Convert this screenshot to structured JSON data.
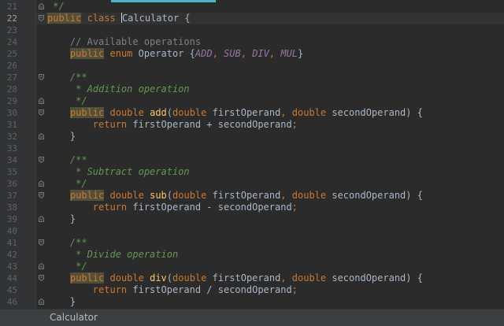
{
  "editor": {
    "current_line": "22",
    "lines": [
      {
        "n": "21",
        "t": " */"
      },
      {
        "n": "22",
        "t": "public class Calculator {"
      },
      {
        "n": "23",
        "t": ""
      },
      {
        "n": "24",
        "t": "    // Available operations"
      },
      {
        "n": "25",
        "t": "    public enum Operator {ADD, SUB, DIV, MUL}"
      },
      {
        "n": "26",
        "t": ""
      },
      {
        "n": "27",
        "t": "    /**"
      },
      {
        "n": "28",
        "t": "     * Addition operation"
      },
      {
        "n": "29",
        "t": "     */"
      },
      {
        "n": "30",
        "t": "    public double add(double firstOperand, double secondOperand) {"
      },
      {
        "n": "31",
        "t": "        return firstOperand + secondOperand;"
      },
      {
        "n": "32",
        "t": "    }"
      },
      {
        "n": "33",
        "t": ""
      },
      {
        "n": "34",
        "t": "    /**"
      },
      {
        "n": "35",
        "t": "     * Subtract operation"
      },
      {
        "n": "36",
        "t": "     */"
      },
      {
        "n": "37",
        "t": "    public double sub(double firstOperand, double secondOperand) {"
      },
      {
        "n": "38",
        "t": "        return firstOperand - secondOperand;"
      },
      {
        "n": "39",
        "t": "    }"
      },
      {
        "n": "40",
        "t": ""
      },
      {
        "n": "41",
        "t": "    /**"
      },
      {
        "n": "42",
        "t": "     * Divide operation"
      },
      {
        "n": "43",
        "t": "     */"
      },
      {
        "n": "44",
        "t": "    public double div(double firstOperand, double secondOperand) {"
      },
      {
        "n": "45",
        "t": "        return firstOperand / secondOperand;"
      },
      {
        "n": "46",
        "t": "    }"
      }
    ],
    "fold_markers": {
      "21": "close",
      "22": "open",
      "27": "open",
      "29": "close",
      "30": "open",
      "32": "close",
      "34": "open",
      "36": "close",
      "37": "open",
      "39": "close",
      "41": "open",
      "43": "close",
      "44": "open",
      "46": "close"
    }
  },
  "status_bar": {
    "label": "Calculator"
  },
  "colors": {
    "background": "#2b2b2b",
    "keyword": "#cc7832",
    "comment": "#808080",
    "doc_comment": "#629755",
    "enum_constant": "#9876aa",
    "method": "#ffc66d",
    "text": "#a9b7c6",
    "scroll_indicator": "#4fb3c9"
  }
}
